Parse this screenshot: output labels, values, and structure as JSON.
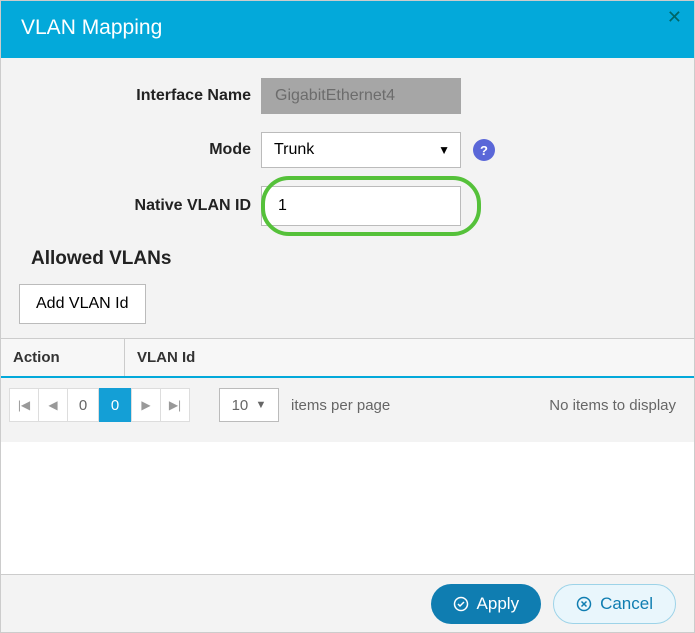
{
  "header": {
    "title": "VLAN Mapping",
    "close": "✕"
  },
  "form": {
    "interface_label": "Interface Name",
    "interface_value": "GigabitEthernet4",
    "mode_label": "Mode",
    "mode_value": "Trunk",
    "native_vlan_label": "Native VLAN ID",
    "native_vlan_value": "1",
    "help_glyph": "?"
  },
  "allowed_vlans": {
    "section_title": "Allowed VLANs",
    "add_button": "Add VLAN Id",
    "col_action": "Action",
    "col_vlan": "VLAN Id"
  },
  "pager": {
    "first": "|◀",
    "prev": "◀",
    "page_inactive": "0",
    "page_active": "0",
    "next": "▶",
    "last": "▶|",
    "items_per_page_value": "10",
    "items_per_page_label": "items per page",
    "empty": "No items to display"
  },
  "footer": {
    "apply": "Apply",
    "cancel": "Cancel"
  }
}
